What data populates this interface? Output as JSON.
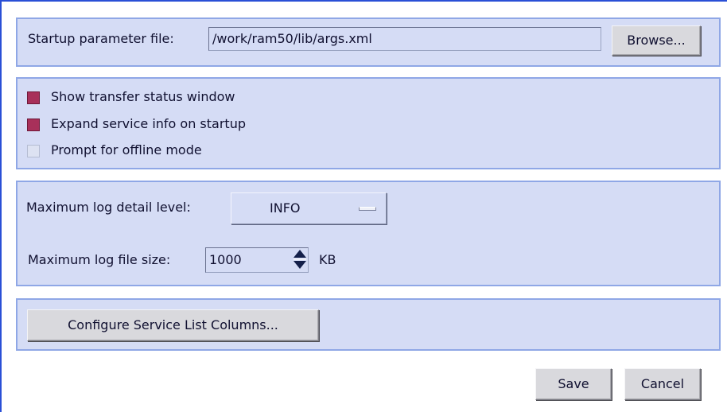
{
  "startup": {
    "label": "Startup parameter file:",
    "file_value": "/work/ram50/lib/args.xml",
    "browse_label": "Browse..."
  },
  "options": {
    "show_transfer_status": {
      "label": "Show transfer status window",
      "checked": true
    },
    "expand_service_info": {
      "label": "Expand service info on startup",
      "checked": true
    },
    "prompt_offline": {
      "label": "Prompt for offline mode",
      "checked": false
    }
  },
  "logging": {
    "detail_label": "Maximum log detail level:",
    "detail_value": "INFO",
    "size_label": "Maximum log file size:",
    "size_value": "1000",
    "size_unit": "KB"
  },
  "columns": {
    "configure_label": "Configure Service List Columns..."
  },
  "footer": {
    "save_label": "Save",
    "cancel_label": "Cancel"
  },
  "colors": {
    "panel_bg": "#d5dcf5",
    "panel_border": "#8fa7e6",
    "checked": "#a8305a",
    "frame_border": "#2a4fd6"
  }
}
